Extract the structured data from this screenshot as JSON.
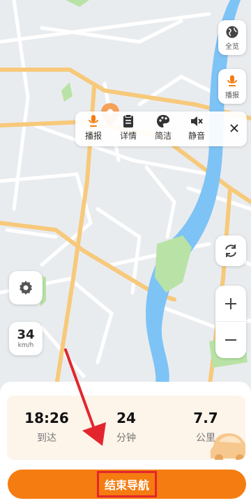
{
  "quickbar": {
    "items": [
      {
        "label": "播报",
        "icon": "mic-icon"
      },
      {
        "label": "详情",
        "icon": "clipboard-icon"
      },
      {
        "label": "简洁",
        "icon": "palette-icon"
      },
      {
        "label": "静音",
        "icon": "speaker-mute-icon"
      }
    ],
    "close_icon": "close-icon"
  },
  "side": {
    "overview_label": "全览",
    "broadcast_label": "播报"
  },
  "speed": {
    "value": "34",
    "unit": "km/h"
  },
  "stats": {
    "arrive": {
      "value": "18:26",
      "label": "到达"
    },
    "duration": {
      "value": "24",
      "label": "分钟"
    },
    "distance": {
      "value": "7.7",
      "label": "公里"
    }
  },
  "end_nav_label": "结束导航",
  "colors": {
    "accent": "#f57c10",
    "highlight_box": "#e3262e",
    "river": "#7ec3f5",
    "park": "#b9e3a6",
    "road_major": "#f7c97a",
    "map_bg": "#e9ecef"
  }
}
